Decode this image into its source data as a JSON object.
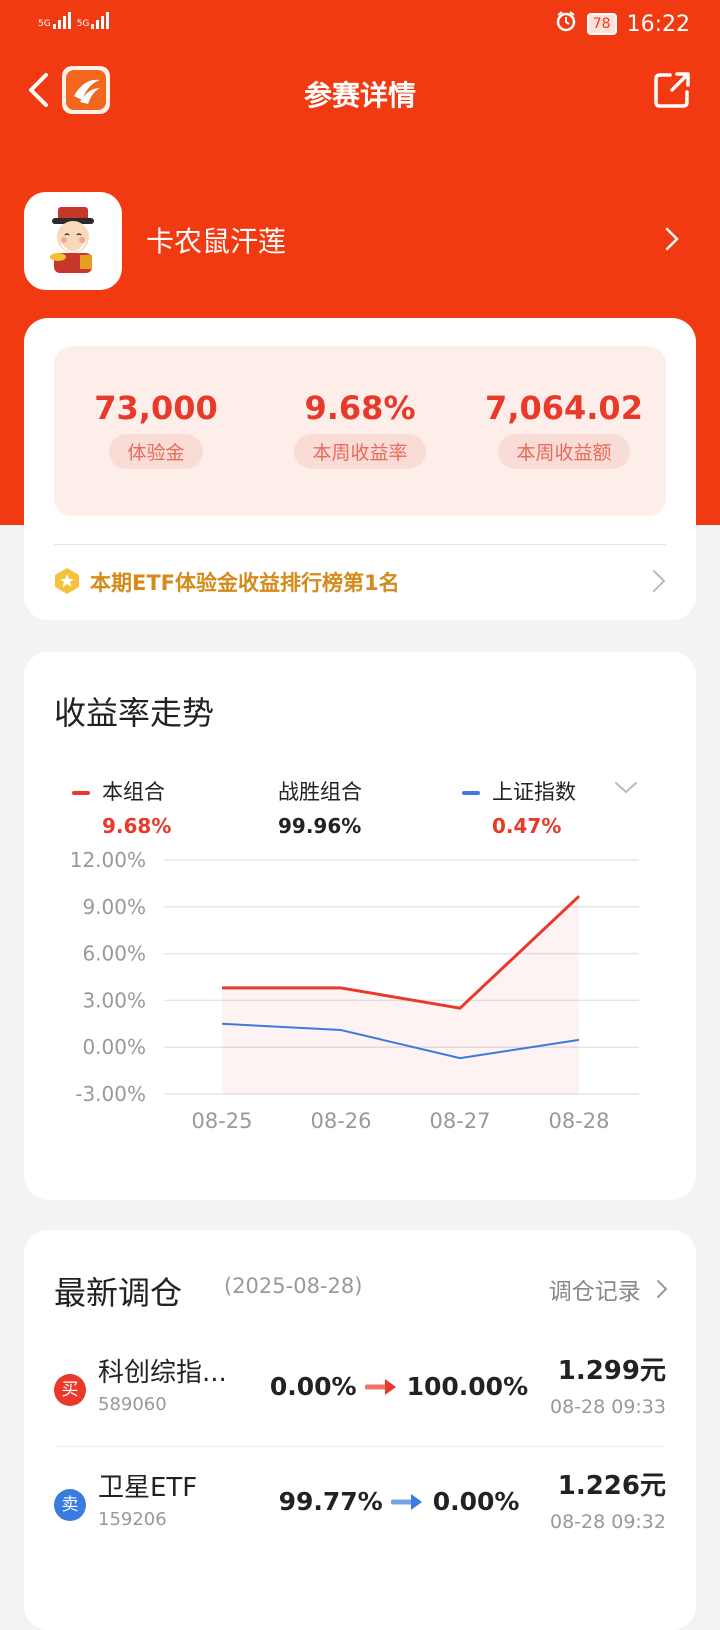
{
  "status_bar": {
    "left_tag_1": "5G",
    "left_tag_2": "5G",
    "battery": "78",
    "time": "16:22"
  },
  "nav": {
    "title": "参赛详情",
    "back_icon": "chevron-left-icon",
    "share_icon": "share-icon"
  },
  "profile": {
    "name": "卡农鼠汗莲"
  },
  "stats": [
    {
      "value": "73,000",
      "label": "体验金"
    },
    {
      "value": "9.68%",
      "label": "本周收益率"
    },
    {
      "value": "7,064.02",
      "label": "本周收益额"
    }
  ],
  "rank": {
    "text": "本期ETF体验金收益排行榜第1名"
  },
  "trend": {
    "title": "收益率走势",
    "legend": [
      {
        "name": "本组合",
        "value": "9.68%",
        "color": "#e8392b"
      },
      {
        "name": "战胜组合",
        "value": "99.96%",
        "color": "#222222"
      },
      {
        "name": "上证指数",
        "value": "0.47%",
        "color": "#3a7be0"
      }
    ]
  },
  "chart_data": {
    "type": "line",
    "x": [
      "08-25",
      "08-26",
      "08-27",
      "08-28"
    ],
    "ylim": [
      -3,
      12
    ],
    "yticks": [
      12,
      9,
      6,
      3,
      0,
      -3
    ],
    "ytick_labels": [
      "12.00%",
      "9.00%",
      "6.00%",
      "3.00%",
      "0.00%",
      "-3.00%"
    ],
    "series": [
      {
        "name": "本组合",
        "values": [
          3.8,
          3.8,
          2.5,
          9.68
        ],
        "color": "#e8392b"
      },
      {
        "name": "上证指数",
        "values": [
          1.5,
          1.1,
          -0.7,
          0.47
        ],
        "color": "#3a7be0"
      }
    ],
    "grid": true
  },
  "trades": {
    "title": "最新调仓",
    "date": "(2025-08-28)",
    "history_label": "调仓记录",
    "rows": [
      {
        "badge": "买",
        "badge_color": "#e8392b",
        "name": "科创综指...",
        "code": "589060",
        "from": "0.00%",
        "to": "100.00%",
        "arrow_color": "#e8392b",
        "price": "1.299元",
        "time": "08-28 09:33"
      },
      {
        "badge": "卖",
        "badge_color": "#3a7be0",
        "name": "卫星ETF",
        "code": "159206",
        "from": "99.77%",
        "to": "0.00%",
        "arrow_color": "#3a7be0",
        "price": "1.226元",
        "time": "08-28 09:32"
      }
    ]
  }
}
